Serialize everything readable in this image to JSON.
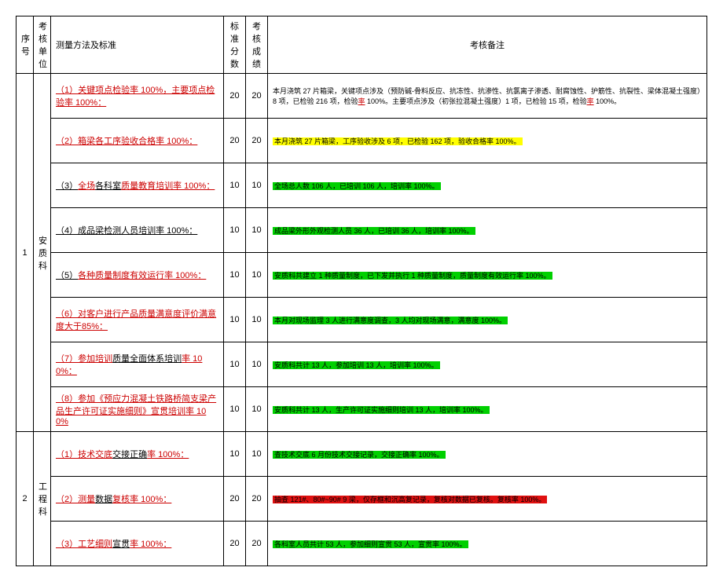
{
  "headers": {
    "seq": "序号",
    "unit": "考核单位",
    "method": "测量方法及标准",
    "std": "标准分数",
    "score": "考核成绩",
    "note": "考核备注"
  },
  "groups": [
    {
      "seq": "1",
      "unit": "安质科",
      "rows": [
        {
          "method_pre": "",
          "method_red": "（1）关键项点检验率 100%，主要项点检验率 100%：",
          "method_post": "",
          "std": "20",
          "score": "20",
          "note_hl": "",
          "note_a": "本月浇筑 27 片箱梁，关键项点涉及（预防碱-骨料反应、抗冻性、抗渗性、抗氯离子渗透、耐腐蚀性、护筋性、抗裂性、梁体混凝土强度）8 项，已检验 216 项，检验",
          "note_red1": "率",
          "note_b": " 100%。主要项点涉及（初张拉混凝土强度）1 项，已检验 15 项，检验",
          "note_red2": "率",
          "note_c": " 100%。"
        },
        {
          "method_pre": "",
          "method_red": "（2）箱梁各工序验收合格率 100%：",
          "method_post": "",
          "std": "20",
          "score": "20",
          "note_hl": "yellow",
          "note": "本月浇筑 27 片箱梁，工序验收涉及 6 项，已检验 162 项，验收合格率 100%。"
        },
        {
          "method_pre": "（3）",
          "method_red": "全场",
          "method_mid": "各科室",
          "method_red2": "质量教育培训率 100%：",
          "method_post": "",
          "std": "10",
          "score": "10",
          "note_hl": "green",
          "note": "全场总人数 106 人，已培训 106 人，培训率 100%。"
        },
        {
          "method_pre": "（4）成品梁检测人员培训率 100%：",
          "method_red": "",
          "method_post": "",
          "std": "10",
          "score": "10",
          "note_hl": "green",
          "note": "成品梁外形外观检测人员 36 人，已培训 36 人，培训率 100%。"
        },
        {
          "method_pre": "（5）",
          "method_red": "各种质量制度有效运行率 100%：",
          "method_post": "",
          "std": "10",
          "score": "10",
          "note_hl": "green",
          "note": "安质科共建立 1 种质量制度，已下发并执行 1 种质量制度，质量制度有效运行率 100%。"
        },
        {
          "method_pre": "",
          "method_red": "（6）对客户进行产品质量满意度评价满意度大于85%：",
          "method_post": "",
          "std": "10",
          "score": "10",
          "note_hl": "green",
          "note": "本月对现场监理 3 人进行满意度调查，3 人均对现场满意，满意度 100%。"
        },
        {
          "method_pre": "",
          "method_red": "（7）参加培训",
          "method_mid": "质量全面体系培训",
          "method_red2": "率 100%：",
          "method_post": "",
          "std": "10",
          "score": "10",
          "note_hl": "green",
          "note": "安质科共计 13 人，参加培训 13 人，培训率 100%。"
        },
        {
          "method_pre": "",
          "method_red": "（8）参加《预应力混凝土铁路桥简支梁产品生产许可证实施细则》宣贯培训率 100%",
          "method_post": "",
          "std": "10",
          "score": "10",
          "note_hl": "green",
          "note": "安质科共计 13 人，生产许可证实施细则培训 13 人，培训率 100%。"
        }
      ]
    },
    {
      "seq": "2",
      "unit": "工程科",
      "rows": [
        {
          "method_pre": "",
          "method_red": "（1）技术交底",
          "method_mid": "交接正确",
          "method_red2": "率 100%：",
          "method_post": "",
          "std": "10",
          "score": "10",
          "note_hl": "green",
          "note": "查技术交底 6 月份技术交接记录，交接正确率 100%。"
        },
        {
          "method_pre": "",
          "method_red": "（2）测量",
          "method_mid": "数据",
          "method_red2": "复核率 100%：",
          "method_post": "",
          "std": "20",
          "score": "20",
          "note_hl": "red",
          "note": "抽查 121#、80#~90# 9 梁，仅存框和沉高复记录，复核对数据已复核。复核率 100%。"
        },
        {
          "method_pre": "",
          "method_red": "（3）工艺细则",
          "method_mid": "宣贯",
          "method_red2": "率 100%：",
          "method_post": "",
          "std": "20",
          "score": "20",
          "note_hl": "green",
          "note": "各科室人员共计 53 人，参加细则宣贯 53 人，宣贯率 100%。"
        }
      ]
    }
  ]
}
